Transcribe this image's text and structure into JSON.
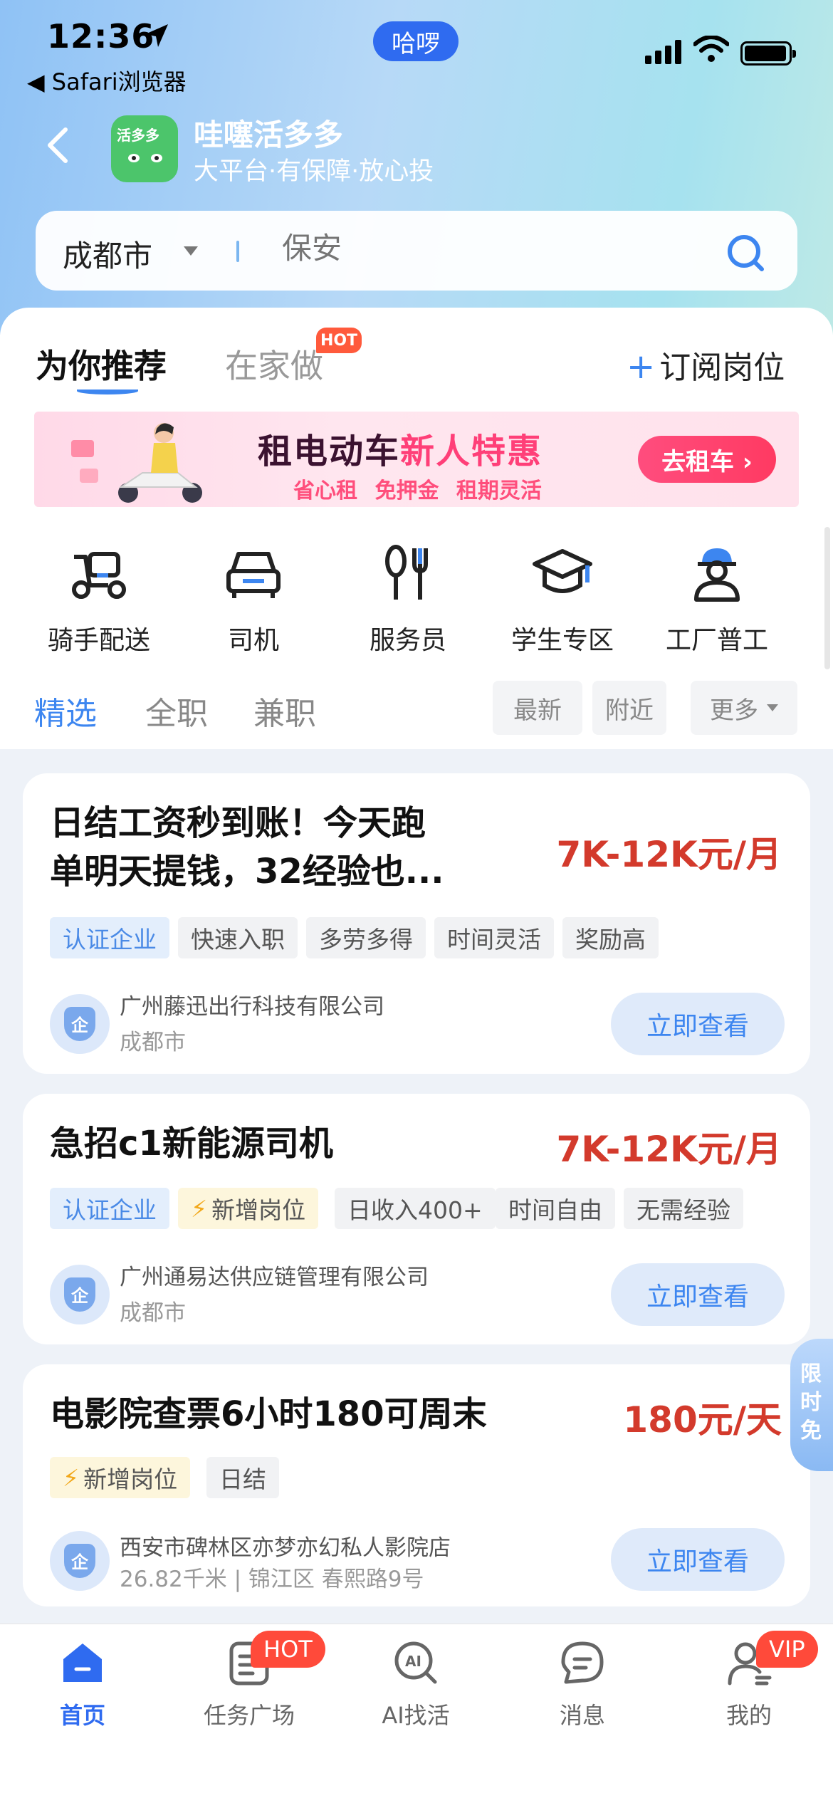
{
  "status_bar": {
    "time": "12:36",
    "back_app": "◀ Safari浏览器",
    "pill": "哈啰"
  },
  "header": {
    "logo_text": "活多多",
    "app_name": "哇噻活多多",
    "slogan": "大平台·有保障·放心投"
  },
  "search": {
    "city": "成都市",
    "placeholder": "保安"
  },
  "tabs": {
    "recommend": "为你推荐",
    "home_work": "在家做",
    "hot_badge": "HOT",
    "subscribe_plus": "+",
    "subscribe": "订阅岗位"
  },
  "banner": {
    "title_a": "租电动车",
    "title_b": "新人特惠",
    "subtitle": "省心租 免押金 租期灵活",
    "button": "去租车 ›"
  },
  "categories": [
    {
      "label": "骑手配送",
      "icon": "scooter-icon"
    },
    {
      "label": "司机",
      "icon": "car-icon"
    },
    {
      "label": "服务员",
      "icon": "cutlery-icon"
    },
    {
      "label": "学生专区",
      "icon": "graduation-cap-icon"
    },
    {
      "label": "工厂普工",
      "icon": "worker-icon"
    }
  ],
  "filters": {
    "tabs": [
      "精选",
      "全职",
      "兼职"
    ],
    "chips": [
      "最新",
      "附近",
      "更多"
    ]
  },
  "jobs": [
    {
      "title_line1": "日结工资秒到账！今天跑",
      "title_line2": "单明天提钱，32经验也...",
      "salary": "7K-12K元/月",
      "tags": [
        "认证企业",
        "快速入职",
        "多劳多得",
        "时间灵活",
        "奖励高"
      ],
      "company": "广州藤迅出行科技有限公司",
      "location": "成都市",
      "button": "立即查看"
    },
    {
      "title": "急招c1新能源司机",
      "salary": "7K-12K元/月",
      "tags": [
        "认证企业",
        "新增岗位",
        "日收入400+",
        "时间自由",
        "无需经验"
      ],
      "company": "广州通易达供应链管理有限公司",
      "location": "成都市",
      "button": "立即查看"
    },
    {
      "title": "电影院查票6小时180可周末",
      "salary": "180元/天",
      "tags": [
        "新增岗位",
        "日结"
      ],
      "company": "西安市碑林区亦梦亦幻私人影院店",
      "location": "26.82千米 | 锦江区 春熙路9号",
      "button": "立即查看"
    }
  ],
  "side_promo": "限时免",
  "avatar_char": "企",
  "bottom_nav": [
    {
      "label": "首页",
      "icon": "home-icon"
    },
    {
      "label": "任务广场",
      "icon": "task-icon",
      "badge": "HOT"
    },
    {
      "label": "AI找活",
      "icon": "ai-search-icon"
    },
    {
      "label": "消息",
      "icon": "message-icon"
    },
    {
      "label": "我的",
      "icon": "profile-icon",
      "badge": "VIP"
    }
  ],
  "colors": {
    "accent": "#3d86f0",
    "salary": "#d33a2c",
    "hot": "#ff4a3a"
  }
}
